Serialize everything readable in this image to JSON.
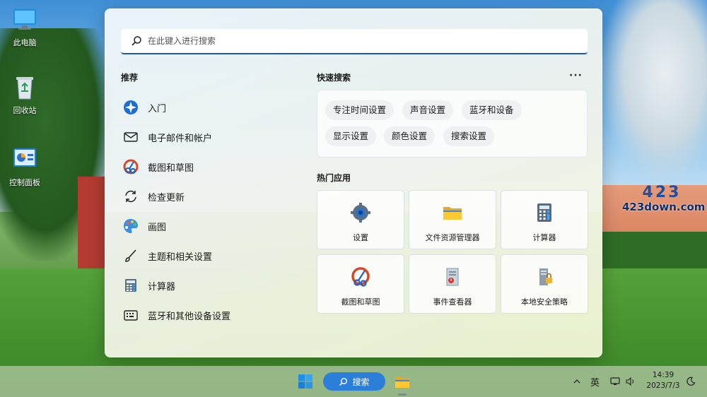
{
  "desktop": {
    "icons": [
      {
        "label": "此电脑",
        "icon": "monitor-icon"
      },
      {
        "label": "回收站",
        "icon": "recycle-bin-icon"
      },
      {
        "label": "控制面板",
        "icon": "control-panel-icon"
      }
    ],
    "watermark": {
      "top": "423",
      "bottom": "423down.com"
    }
  },
  "search": {
    "placeholder": "在此键入进行搜索",
    "value": ""
  },
  "recommended": {
    "title": "推荐",
    "items": [
      {
        "label": "入门",
        "icon": "get-started-icon"
      },
      {
        "label": "电子邮件和帐户",
        "icon": "mail-icon"
      },
      {
        "label": "截图和草图",
        "icon": "snip-sketch-icon"
      },
      {
        "label": "检查更新",
        "icon": "update-icon"
      },
      {
        "label": "画图",
        "icon": "paint-icon"
      },
      {
        "label": "主题和相关设置",
        "icon": "brush-icon"
      },
      {
        "label": "计算器",
        "icon": "calculator-icon"
      },
      {
        "label": "蓝牙和其他设备设置",
        "icon": "bluetooth-devices-icon"
      }
    ]
  },
  "quick_search": {
    "title": "快速搜索",
    "more_label": "···",
    "chips": [
      "专注时间设置",
      "声音设置",
      "蓝牙和设备",
      "显示设置",
      "颜色设置",
      "搜索设置"
    ]
  },
  "top_apps": {
    "title": "热门应用",
    "apps": [
      {
        "label": "设置",
        "icon": "settings-gear-icon"
      },
      {
        "label": "文件资源管理器",
        "icon": "folder-icon"
      },
      {
        "label": "计算器",
        "icon": "calculator-icon"
      },
      {
        "label": "截图和草图",
        "icon": "snip-sketch-icon"
      },
      {
        "label": "事件查看器",
        "icon": "event-viewer-icon"
      },
      {
        "label": "本地安全策略",
        "icon": "security-policy-icon"
      }
    ]
  },
  "taskbar": {
    "search_label": "搜索",
    "tray": {
      "ime": "英",
      "chevron": "^"
    },
    "clock": {
      "time": "14:39",
      "date": "2023/7/3"
    }
  },
  "colors": {
    "accent": "#1a56b8",
    "search_pill": "#2b7fd8"
  }
}
